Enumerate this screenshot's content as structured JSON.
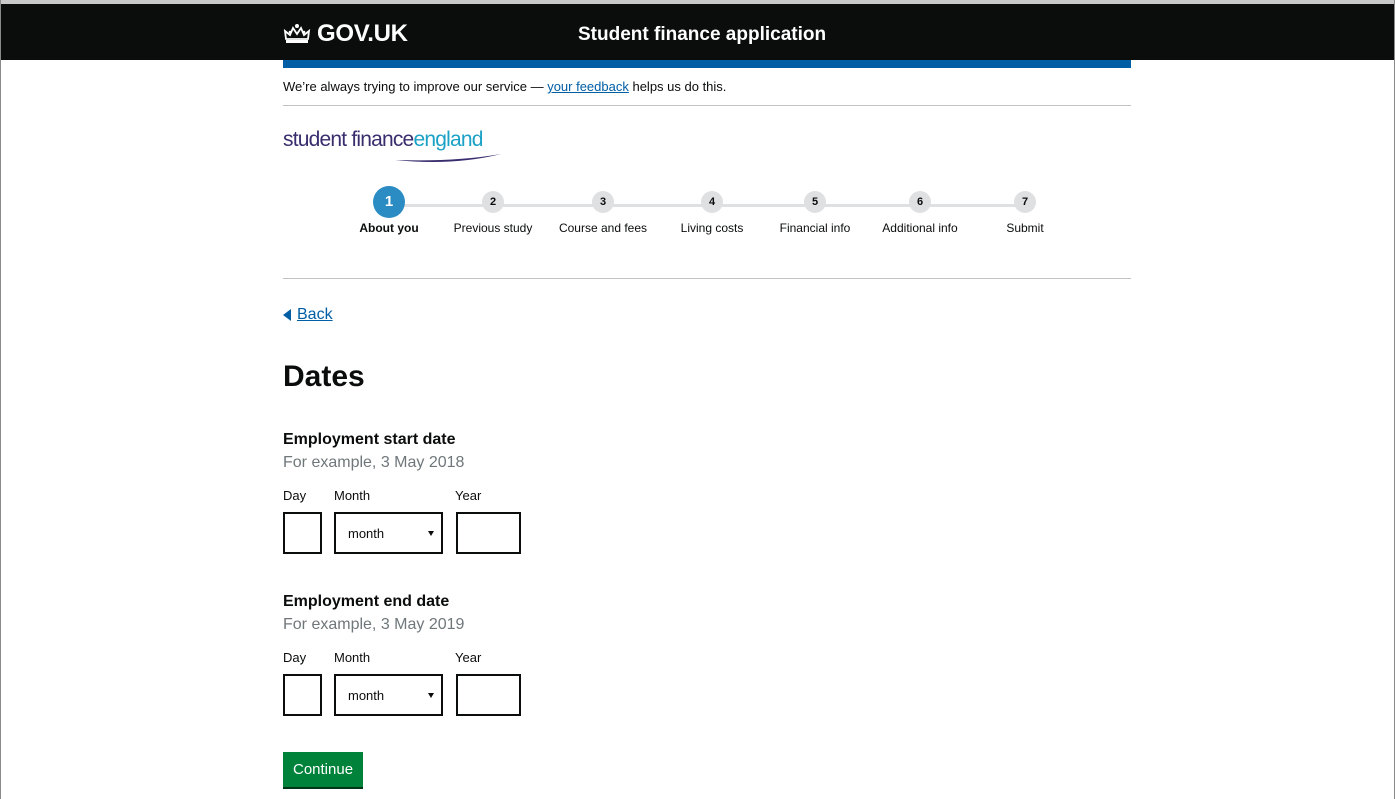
{
  "header": {
    "logo_text": "GOV.UK",
    "service_name": "Student finance application"
  },
  "feedback": {
    "prefix": "We’re always trying to improve our service — ",
    "link_text": "your feedback",
    "suffix": " helps us do this."
  },
  "brand": {
    "part1": "student finance",
    "part2": "england"
  },
  "stepper": {
    "current_step": 1,
    "steps": [
      {
        "number": "1",
        "label": "About you"
      },
      {
        "number": "2",
        "label": "Previous study"
      },
      {
        "number": "3",
        "label": "Course and fees"
      },
      {
        "number": "4",
        "label": "Living costs"
      },
      {
        "number": "5",
        "label": "Financial info"
      },
      {
        "number": "6",
        "label": "Additional info"
      },
      {
        "number": "7",
        "label": "Submit"
      }
    ]
  },
  "back_link": "Back",
  "page_title": "Dates",
  "start_date": {
    "legend": "Employment start date",
    "hint": "For example, 3 May 2018",
    "day_label": "Day",
    "month_label": "Month",
    "year_label": "Year",
    "day_value": "",
    "month_value": "month",
    "year_value": ""
  },
  "end_date": {
    "legend": "Employment end date",
    "hint": "For example, 3 May 2019",
    "day_label": "Day",
    "month_label": "Month",
    "year_label": "Year",
    "day_value": "",
    "month_value": "month",
    "year_value": ""
  },
  "continue_label": "Continue",
  "colors": {
    "header_bg": "#0b0c0c",
    "brand_blue": "#005ea5",
    "active_step": "#2b8cc4",
    "button_green": "#00823b"
  }
}
